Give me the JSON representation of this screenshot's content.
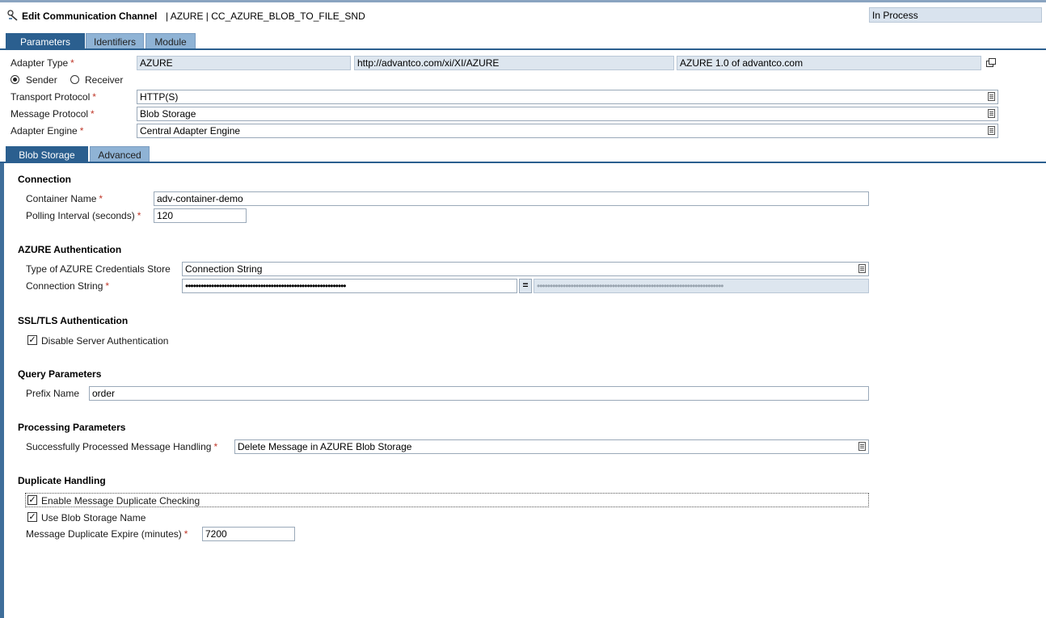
{
  "header": {
    "title": "Edit Communication Channel",
    "object": "| AZURE | CC_AZURE_BLOB_TO_FILE_SND",
    "status": "In Process"
  },
  "tabs": [
    {
      "label": "Parameters",
      "active": true
    },
    {
      "label": "Identifiers",
      "active": false
    },
    {
      "label": "Module",
      "active": false
    }
  ],
  "adapter": {
    "type_label": "Adapter Type",
    "type_value": "AZURE",
    "namespace": "http://advantco.com/xi/XI/AZURE",
    "software": "AZURE 1.0 of advantco.com",
    "sender_label": "Sender",
    "receiver_label": "Receiver",
    "transport_label": "Transport Protocol",
    "transport_value": "HTTP(S)",
    "message_label": "Message Protocol",
    "message_value": "Blob Storage",
    "engine_label": "Adapter Engine",
    "engine_value": "Central Adapter Engine"
  },
  "subtabs": [
    {
      "label": "Blob Storage",
      "active": true
    },
    {
      "label": "Advanced",
      "active": false
    }
  ],
  "connection": {
    "heading": "Connection",
    "container_label": "Container Name",
    "container_value": "adv-container-demo",
    "polling_label": "Polling Interval (seconds)",
    "polling_value": "120"
  },
  "auth": {
    "heading": "AZURE Authentication",
    "store_label": "Type of AZURE Credentials Store",
    "store_value": "Connection String",
    "conn_label": "Connection String",
    "conn_mask": "••••••••••••••••••••••••••••••••••••••••••••••••••••••••••••••",
    "conn_mask_confirm": "••••••••••••••••••••••••••••••••••••••••••••••••••••••••••••••••••••••••"
  },
  "ssl": {
    "heading": "SSL/TLS Authentication",
    "disable_label": "Disable Server Authentication"
  },
  "query": {
    "heading": "Query Parameters",
    "prefix_label": "Prefix Name",
    "prefix_value": "order"
  },
  "processing": {
    "heading": "Processing Parameters",
    "handling_label": "Successfully Processed Message Handling",
    "handling_value": "Delete Message in AZURE Blob Storage"
  },
  "duplicate": {
    "heading": "Duplicate Handling",
    "enable_label": "Enable Message Duplicate Checking",
    "blobname_label": "Use Blob Storage Name",
    "expire_label": "Message Duplicate Expire (minutes)",
    "expire_value": "7200"
  },
  "required_mark": "*",
  "colors": {
    "tab_active": "#2b5f8f",
    "tab_inactive": "#8fb3d5",
    "readonly_bg": "#dde6ef"
  }
}
